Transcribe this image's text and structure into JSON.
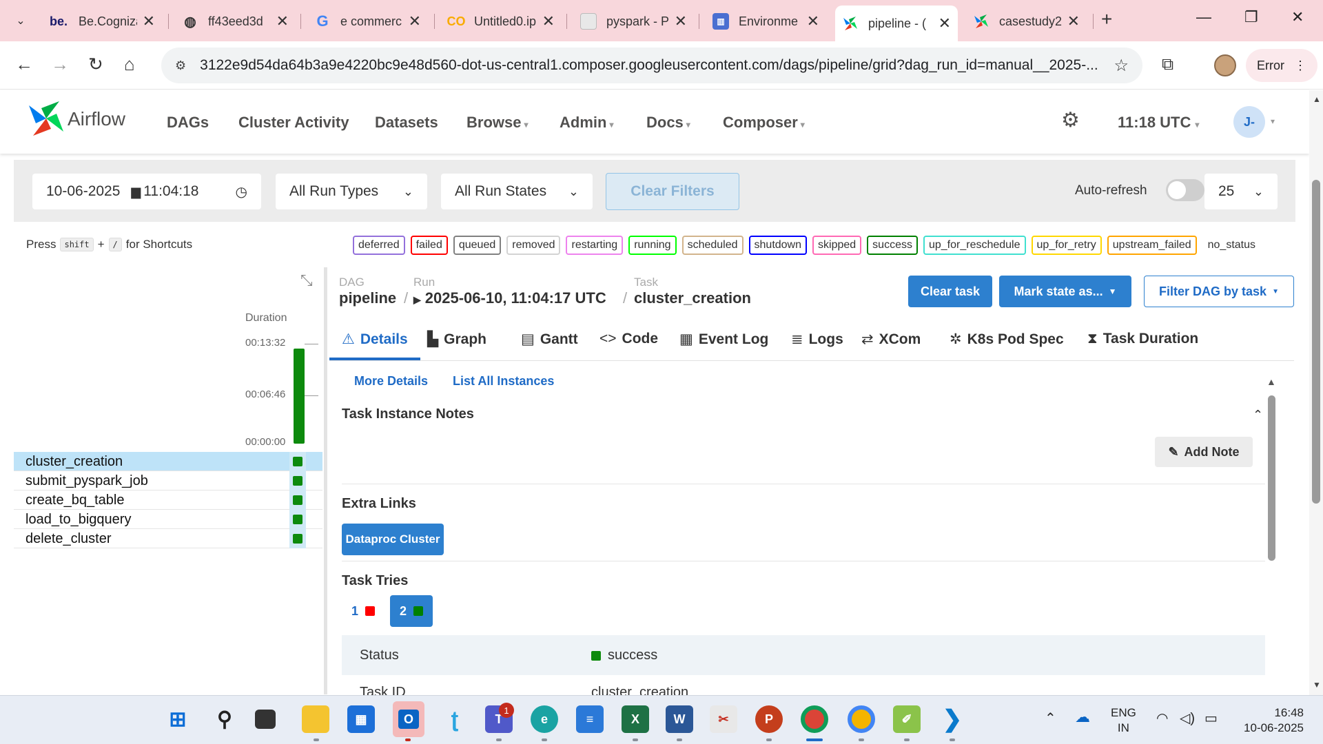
{
  "browser": {
    "tabs": [
      {
        "icon": "be-icon",
        "label": "Be.Cogniza",
        "active": false
      },
      {
        "icon": "globe-icon",
        "label": "ff43eed3d",
        "active": false
      },
      {
        "icon": "google-icon",
        "label": "e commerc",
        "active": false
      },
      {
        "icon": "colab-icon",
        "label": "Untitled0.ip",
        "active": false
      },
      {
        "icon": "page-icon",
        "label": "pyspark - P",
        "active": false
      },
      {
        "icon": "composer-icon",
        "label": "Environme",
        "active": false
      },
      {
        "icon": "airflow-icon",
        "label": "pipeline - (",
        "active": true
      },
      {
        "icon": "airflow-icon",
        "label": "casestudy2",
        "active": false
      }
    ],
    "favicon_texts": {
      "be": "be."
    },
    "url": "3122e9d54da64b3a9e4220bc9e48d560-dot-us-central1.composer.googleusercontent.com/dags/pipeline/grid?dag_run_id=manual__2025-...",
    "error_label": "Error"
  },
  "airflow": {
    "brand": "Airflow",
    "menu": [
      {
        "label": "DAGs",
        "dropdown": false
      },
      {
        "label": "Cluster Activity",
        "dropdown": false
      },
      {
        "label": "Datasets",
        "dropdown": false
      },
      {
        "label": "Browse",
        "dropdown": true
      },
      {
        "label": "Admin",
        "dropdown": true
      },
      {
        "label": "Docs",
        "dropdown": true
      },
      {
        "label": "Composer",
        "dropdown": true
      }
    ],
    "time": "11:18 UTC",
    "avatar": "J-"
  },
  "filters": {
    "date": "10-06-2025",
    "time": "11:04:18",
    "run_types": "All Run Types",
    "run_states": "All Run States",
    "clear": "Clear Filters",
    "auto_refresh": "Auto-refresh",
    "auto_refresh_on": false,
    "page_size": "25"
  },
  "shortcuts": {
    "press": "Press",
    "key1": "shift",
    "plus": "+",
    "key2": "/",
    "suffix": "for Shortcuts"
  },
  "legend": [
    {
      "label": "deferred",
      "color": "#9370db"
    },
    {
      "label": "failed",
      "color": "#ff0000"
    },
    {
      "label": "queued",
      "color": "#808080"
    },
    {
      "label": "removed",
      "color": "#d3d3d3"
    },
    {
      "label": "restarting",
      "color": "#ee82ee"
    },
    {
      "label": "running",
      "color": "#00ff00"
    },
    {
      "label": "scheduled",
      "color": "#d2b48c"
    },
    {
      "label": "shutdown",
      "color": "#0000ff"
    },
    {
      "label": "skipped",
      "color": "#ff69b4"
    },
    {
      "label": "success",
      "color": "#008000"
    },
    {
      "label": "up_for_reschedule",
      "color": "#40e0d0"
    },
    {
      "label": "up_for_retry",
      "color": "#ffd700"
    },
    {
      "label": "upstream_failed",
      "color": "#ffa500"
    }
  ],
  "legend_no_status": "no_status",
  "grid": {
    "duration_label": "Duration",
    "ticks": [
      "00:13:32",
      "00:06:46",
      "00:00:00"
    ],
    "run_duration_fraction": 0.97,
    "tasks": [
      {
        "name": "cluster_creation",
        "state": "success",
        "selected": true
      },
      {
        "name": "submit_pyspark_job",
        "state": "success",
        "selected": false
      },
      {
        "name": "create_bq_table",
        "state": "success",
        "selected": false
      },
      {
        "name": "load_to_bigquery",
        "state": "success",
        "selected": false
      },
      {
        "name": "delete_cluster",
        "state": "success",
        "selected": false
      }
    ]
  },
  "breadcrumb": {
    "dag_label": "DAG",
    "dag": "pipeline",
    "run_label": "Run",
    "run": "2025-06-10, 11:04:17 UTC",
    "task_label": "Task",
    "task": "cluster_creation",
    "sep": "/"
  },
  "actions": {
    "clear_task": "Clear task",
    "mark_state": "Mark state as...",
    "filter_dag": "Filter DAG by task"
  },
  "detail_tabs": [
    {
      "label": "Details",
      "icon": "warning-triangle-icon",
      "glyph": "⚠"
    },
    {
      "label": "Graph",
      "icon": "graph-icon",
      "glyph": "▙"
    },
    {
      "label": "Gantt",
      "icon": "gantt-icon",
      "glyph": "▤"
    },
    {
      "label": "Code",
      "icon": "code-icon",
      "glyph": "<>"
    },
    {
      "label": "Event Log",
      "icon": "event-log-icon",
      "glyph": "▦"
    },
    {
      "label": "Logs",
      "icon": "logs-icon",
      "glyph": "≣"
    },
    {
      "label": "XCom",
      "icon": "xcom-icon",
      "glyph": "⇄"
    },
    {
      "label": "K8s Pod Spec",
      "icon": "k8s-icon",
      "glyph": "✲"
    },
    {
      "label": "Task Duration",
      "icon": "hourglass-icon",
      "glyph": "⧗"
    }
  ],
  "details": {
    "more_details": "More Details",
    "list_instances": "List All Instances",
    "notes_title": "Task Instance Notes",
    "add_note": "Add Note",
    "extra_links_title": "Extra Links",
    "dataproc_button": "Dataproc Cluster",
    "task_tries_title": "Task Tries",
    "tries": [
      {
        "label": "1",
        "state_color": "#ff0000",
        "selected": false
      },
      {
        "label": "2",
        "state_color": "#008000",
        "selected": true
      }
    ],
    "status_key": "Status",
    "status_value": "success",
    "next_key": "Task ID",
    "next_value": "cluster_creation"
  },
  "system": {
    "lang1": "ENG",
    "lang2": "IN",
    "time": "16:48",
    "date": "10-06-2025",
    "teams_badge": "1"
  }
}
